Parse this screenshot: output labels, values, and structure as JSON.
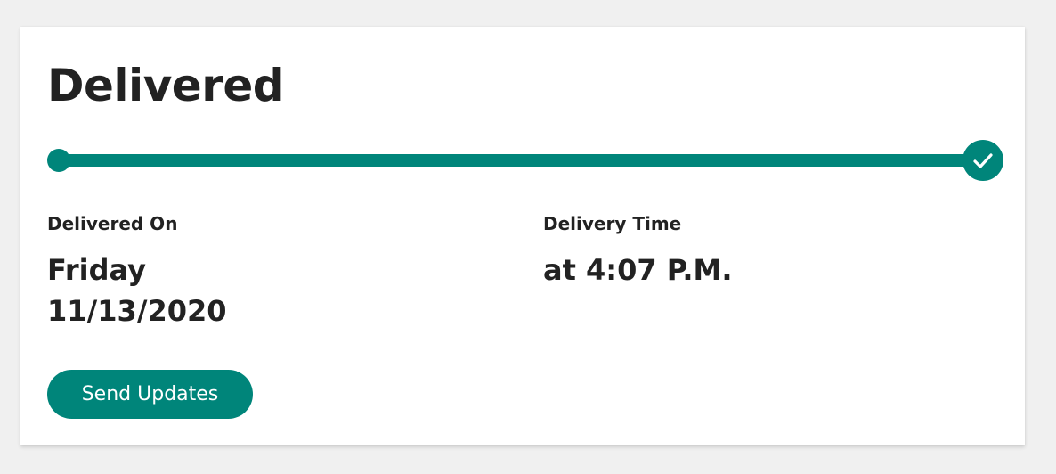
{
  "status": {
    "title": "Delivered",
    "progress_fraction": 1.0,
    "completed_icon": "check-icon"
  },
  "delivered_on": {
    "label": "Delivered On",
    "day": "Friday",
    "date": "11/13/2020"
  },
  "delivery_time": {
    "label": "Delivery Time",
    "value": "at 4:07 P.M."
  },
  "actions": {
    "send_updates_label": "Send Updates"
  },
  "colors": {
    "accent": "#00857a",
    "text": "#222222",
    "page_background": "#f0f0f0",
    "card_background": "#ffffff"
  }
}
